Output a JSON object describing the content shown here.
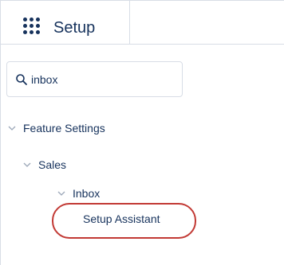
{
  "header": {
    "app_title": "Setup",
    "launcher_icon": "app-launcher-waffle-icon"
  },
  "search": {
    "value": "inbox",
    "icon": "search-icon"
  },
  "tree": {
    "feature_settings_label": "Feature Settings",
    "sales_label": "Sales",
    "inbox_label": "Inbox",
    "setup_assistant_label": "Setup Assistant"
  },
  "colors": {
    "text": "#16325c",
    "border": "#d8dde6",
    "highlight": "#c23934",
    "chevron": "#9ba7b8"
  }
}
